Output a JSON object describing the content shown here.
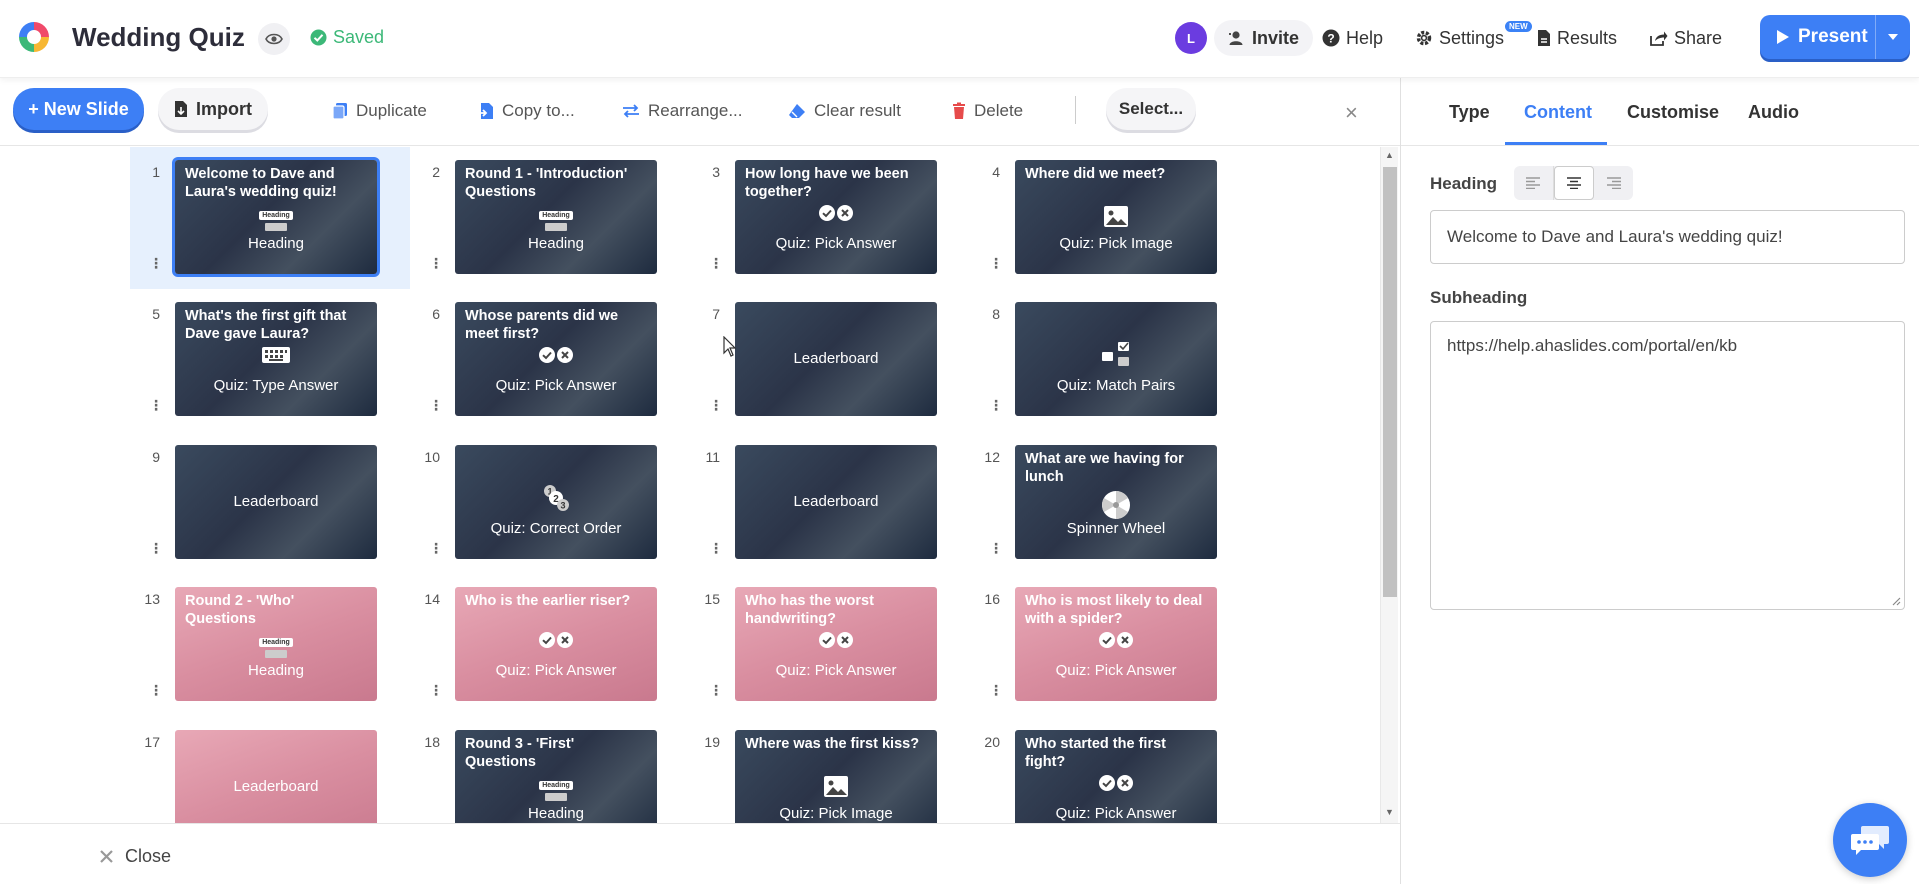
{
  "header": {
    "title": "Wedding Quiz",
    "saved_label": "Saved",
    "avatar_initial": "L",
    "invite_label": "Invite",
    "help_label": "Help",
    "settings_label": "Settings",
    "new_badge": "NEW",
    "results_label": "Results",
    "share_label": "Share",
    "present_label": "Present",
    "accent_color": "#3d7ff5"
  },
  "toolbar": {
    "new_slide_label": "+ New Slide",
    "import_label": "Import",
    "duplicate_label": "Duplicate",
    "copy_to_label": "Copy to...",
    "rearrange_label": "Rearrange...",
    "clear_result_label": "Clear result",
    "delete_label": "Delete",
    "select_label": "Select...",
    "close_glyph": "×"
  },
  "slides": [
    {
      "num": "1",
      "title": "Welcome to Dave and Laura's wedding quiz!",
      "type": "Heading",
      "icon": "heading-icon",
      "theme": "dark",
      "selected": true
    },
    {
      "num": "2",
      "title": "Round 1 - 'Introduction' Questions",
      "type": "Heading",
      "icon": "heading-icon",
      "theme": "dark"
    },
    {
      "num": "3",
      "title": "How long have we been together?",
      "type": "Quiz: Pick Answer",
      "icon": "pick-answer-icon",
      "theme": "dark"
    },
    {
      "num": "4",
      "title": "Where did we meet?",
      "type": "Quiz: Pick Image",
      "icon": "pick-image-icon",
      "theme": "dark"
    },
    {
      "num": "5",
      "title": "What's the first gift that Dave gave Laura?",
      "type": "Quiz: Type Answer",
      "icon": "keyboard-icon",
      "theme": "dark"
    },
    {
      "num": "6",
      "title": "Whose parents did we meet first?",
      "type": "Quiz: Pick Answer",
      "icon": "pick-answer-icon",
      "theme": "dark"
    },
    {
      "num": "7",
      "title": "",
      "type": "Leaderboard",
      "icon": "",
      "theme": "dark"
    },
    {
      "num": "8",
      "title": "",
      "type": "Quiz: Match Pairs",
      "icon": "match-pairs-icon",
      "theme": "dark"
    },
    {
      "num": "9",
      "title": "",
      "type": "Leaderboard",
      "icon": "",
      "theme": "dark"
    },
    {
      "num": "10",
      "title": "",
      "type": "Quiz: Correct Order",
      "icon": "correct-order-icon",
      "theme": "dark"
    },
    {
      "num": "11",
      "title": "",
      "type": "Leaderboard",
      "icon": "",
      "theme": "dark"
    },
    {
      "num": "12",
      "title": "What are we having for lunch",
      "type": "Spinner Wheel",
      "icon": "spinner-wheel-icon",
      "theme": "dark"
    },
    {
      "num": "13",
      "title": "Round 2 - 'Who' Questions",
      "type": "Heading",
      "icon": "heading-icon",
      "theme": "pink"
    },
    {
      "num": "14",
      "title": "Who is the earlier riser?",
      "type": "Quiz: Pick Answer",
      "icon": "pick-answer-icon",
      "theme": "pink"
    },
    {
      "num": "15",
      "title": "Who has the worst handwriting?",
      "type": "Quiz: Pick Answer",
      "icon": "pick-answer-icon",
      "theme": "pink"
    },
    {
      "num": "16",
      "title": "Who is most likely to deal with a spider?",
      "type": "Quiz: Pick Answer",
      "icon": "pick-answer-icon",
      "theme": "pink"
    },
    {
      "num": "17",
      "title": "",
      "type": "Leaderboard",
      "icon": "",
      "theme": "pink"
    },
    {
      "num": "18",
      "title": "Round 3 - 'First' Questions",
      "type": "Heading",
      "icon": "heading-icon",
      "theme": "dark"
    },
    {
      "num": "19",
      "title": "Where was the first kiss?",
      "type": "Quiz: Pick Image",
      "icon": "pick-image-icon",
      "theme": "dark"
    },
    {
      "num": "20",
      "title": "Who started the first fight?",
      "type": "Quiz: Pick Answer",
      "icon": "pick-answer-icon",
      "theme": "dark"
    }
  ],
  "heading_mini_label": "Heading",
  "bottom": {
    "close_label": "Close"
  },
  "panel": {
    "tabs": [
      "Type",
      "Content",
      "Customise",
      "Audio"
    ],
    "active_tab": "Content",
    "heading_label": "Heading",
    "heading_value": "Welcome to Dave and Laura's wedding quiz!",
    "subheading_label": "Subheading",
    "subheading_value": "https://help.ahaslides.com/portal/en/kb"
  }
}
